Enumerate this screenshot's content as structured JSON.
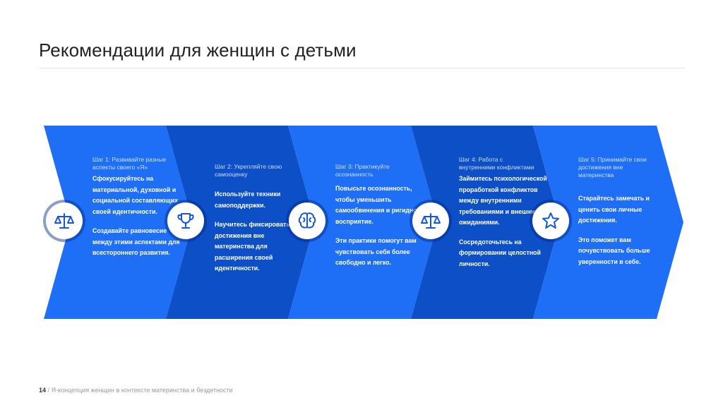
{
  "slide": {
    "title": "Рекомендации для женщин с детьми",
    "page_number": "14",
    "footer_sep": "/",
    "footer_text": "Я-концепция женщин в контексте материнства и бездетности"
  },
  "colors": {
    "chevron_light": "#1e6ff5",
    "chevron_dark": "#0d4fc7",
    "icon_blue": "#1756d6"
  },
  "steps": [
    {
      "icon": "scales-icon",
      "header": "Шаг 1: Развивайте разные аспекты своего «Я»",
      "paragraphs": [
        "Сфокусируйтесь на материальной, духовной и социальной составляющих своей идентичности.",
        "Создавайте равновесие между этими аспектами для всестороннего развития."
      ]
    },
    {
      "icon": "trophy-icon",
      "header": "Шаг 2: Укрепляйте свою самооценку",
      "paragraphs": [
        "Используйте техники самоподдержки.",
        "Научитесь фиксировать достижения вне материнства для расширения своей идентичности."
      ]
    },
    {
      "icon": "brain-icon",
      "header": "Шаг 3: Практикуйте осознанность",
      "paragraphs": [
        "Повысьте осознанность, чтобы уменьшить самообвинения и ригидное восприятие.",
        "Эти практики помогут вам чувствовать себя более свободно и легко."
      ]
    },
    {
      "icon": "scales-icon",
      "header": "Шаг 4: Работа с внутренними конфликтами",
      "paragraphs": [
        "Займитесь психологической проработкой конфликтов между внутренними требованиями и внешними ожиданиями.",
        "Сосредоточьтесь на формировании целостной личности."
      ]
    },
    {
      "icon": "star-icon",
      "header": "Шаг 5: Принимайте свои достижения вне материнства",
      "paragraphs": [
        "Старайтесь замечать и ценить свои личные достижения.",
        "Это поможет вам почувствовать больше уверенности в себе."
      ]
    }
  ]
}
